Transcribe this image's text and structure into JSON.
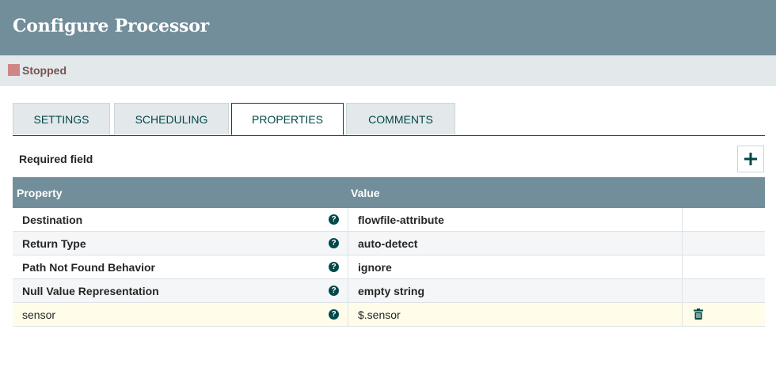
{
  "header": {
    "title": "Configure Processor"
  },
  "status": {
    "label": "Stopped",
    "color": "#d18686"
  },
  "tabs": [
    {
      "label": "SETTINGS",
      "active": false
    },
    {
      "label": "SCHEDULING",
      "active": false
    },
    {
      "label": "PROPERTIES",
      "active": true
    },
    {
      "label": "COMMENTS",
      "active": false
    }
  ],
  "required_label": "Required field",
  "add_button_icon": "plus-icon",
  "table": {
    "columns": [
      "Property",
      "Value"
    ],
    "rows": [
      {
        "name": "Destination",
        "value": "flowfile-attribute",
        "user_defined": false
      },
      {
        "name": "Return Type",
        "value": "auto-detect",
        "user_defined": false
      },
      {
        "name": "Path Not Found Behavior",
        "value": "ignore",
        "user_defined": false
      },
      {
        "name": "Null Value Representation",
        "value": "empty string",
        "user_defined": false
      },
      {
        "name": "sensor",
        "value": "$.sensor",
        "user_defined": true
      }
    ]
  },
  "colors": {
    "header_bg": "#728e9b",
    "accent": "#004849",
    "status_bar_bg": "#e3e8eb"
  }
}
